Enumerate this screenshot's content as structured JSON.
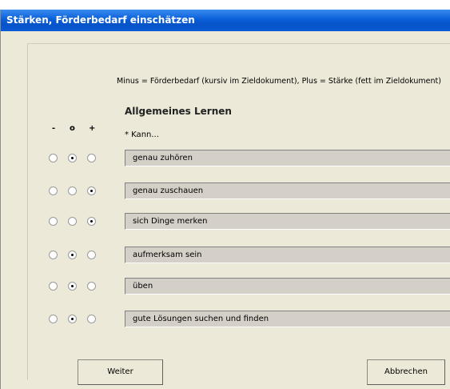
{
  "window": {
    "title": "Stärken, Förderbedarf einschätzen"
  },
  "hint": "Minus = Förderbedarf (kursiv im Zieldokument), Plus = Stärke (fett im Zieldokument)",
  "section": {
    "title": "Allgemeines Lernen",
    "prompt": "* Kann..."
  },
  "columns": {
    "minus": "-",
    "neutral": "o",
    "plus": "+"
  },
  "items": [
    {
      "label": "genau zuhören",
      "selected": "o"
    },
    {
      "label": "genau zuschauen",
      "selected": "+"
    },
    {
      "label": "sich Dinge merken",
      "selected": "+"
    },
    {
      "label": "aufmerksam sein",
      "selected": "o"
    },
    {
      "label": "üben",
      "selected": "o"
    },
    {
      "label": "gute Lösungen suchen und finden",
      "selected": "o"
    }
  ],
  "buttons": {
    "next": "Weiter",
    "cancel": "Abbrechen"
  }
}
